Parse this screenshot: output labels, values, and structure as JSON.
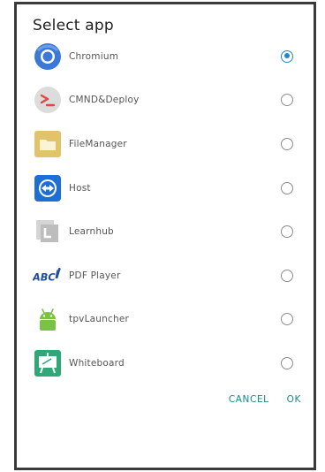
{
  "dialog": {
    "title": "Select app",
    "apps": [
      {
        "label": "Chromium",
        "icon": "chromium-icon",
        "selected": true
      },
      {
        "label": "CMND&Deploy",
        "icon": "cmnd-deploy-icon",
        "selected": false
      },
      {
        "label": "FileManager",
        "icon": "folder-icon",
        "selected": false
      },
      {
        "label": "Host",
        "icon": "host-icon",
        "selected": false
      },
      {
        "label": "Learnhub",
        "icon": "learnhub-icon",
        "selected": false
      },
      {
        "label": "PDF Player",
        "icon": "pdf-player-icon",
        "selected": false,
        "icon_text": "ABC"
      },
      {
        "label": "tpvLauncher",
        "icon": "android-icon",
        "selected": false
      },
      {
        "label": "Whiteboard",
        "icon": "whiteboard-icon",
        "selected": false
      }
    ],
    "cancel_label": "CANCEL",
    "ok_label": "OK"
  },
  "colors": {
    "accent": "#1e88c9",
    "action_text": "#168a8a",
    "frame_border": "#3a3a3a"
  }
}
